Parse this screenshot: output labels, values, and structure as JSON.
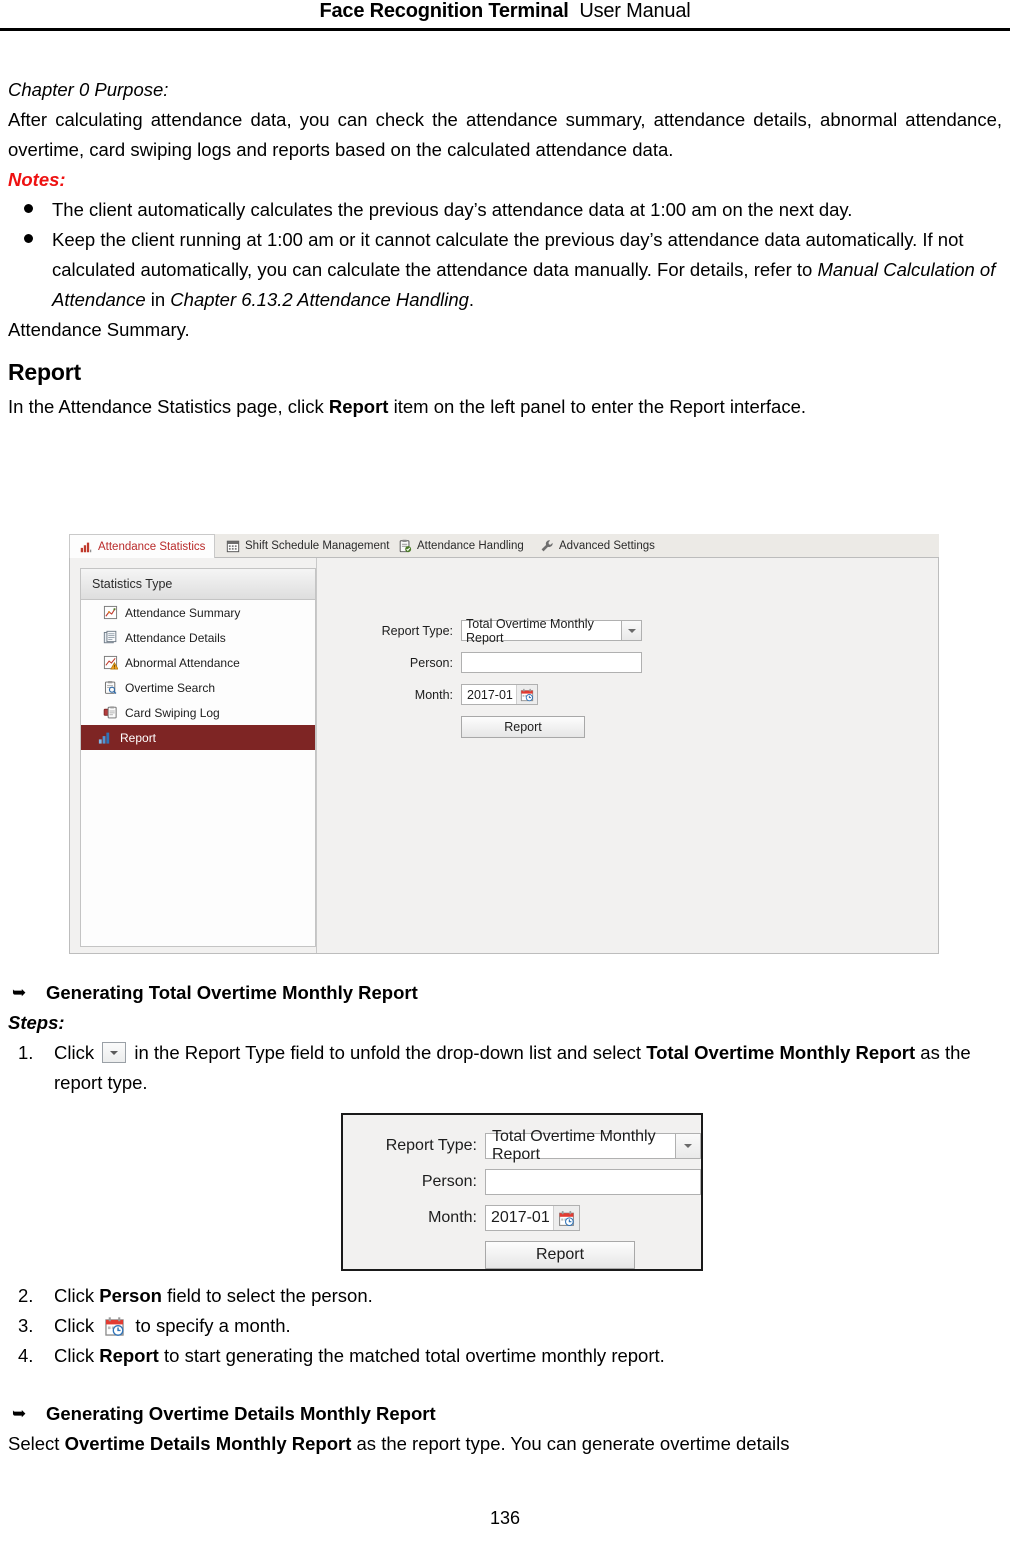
{
  "header": {
    "title_bold": "Face Recognition Terminal",
    "title_regular": "User Manual"
  },
  "content": {
    "chapter_purpose_label": "Chapter 0 Purpose:",
    "purpose_paragraph": "After calculating attendance data, you can check the attendance summary, attendance details, abnormal attendance, overtime, card swiping logs and reports based on the calculated attendance data.",
    "notes_label": "Notes:",
    "notes": [
      "The client automatically calculates the previous day’s attendance data at 1:00 am on the next day.",
      "Keep the client running at 1:00 am or it cannot calculate the previous day’s attendance data automatically. If not calculated automatically, you can calculate the attendance data manually. For details, refer to "
    ],
    "note2_italic_a": "Manual Calculation of Attendance",
    "note2_mid": " in ",
    "note2_italic_b": "Chapter 6.13.2 Attendance Handling",
    "note2_end": ".",
    "attendance_summary_line": "Attendance Summary.",
    "section_heading": "Report",
    "intro_a": "In the Attendance Statistics page, click ",
    "intro_bold": "Report",
    "intro_b": " item on the left panel to enter the Report interface."
  },
  "screenshot": {
    "tabs": [
      {
        "label": "Attendance Statistics",
        "icon": "bar-chart-icon",
        "active": true
      },
      {
        "label": "Shift Schedule Management",
        "icon": "calendar-grid-icon",
        "active": false
      },
      {
        "label": "Attendance Handling",
        "icon": "clipboard-check-icon",
        "active": false
      },
      {
        "label": "Advanced Settings",
        "icon": "wrench-icon",
        "active": false
      }
    ],
    "sidebar": {
      "title": "Statistics Type",
      "items": [
        {
          "label": "Attendance Summary",
          "icon": "chart-line-icon",
          "selected": false
        },
        {
          "label": "Attendance Details",
          "icon": "document-list-icon",
          "selected": false
        },
        {
          "label": "Abnormal Attendance",
          "icon": "warning-chart-icon",
          "selected": false
        },
        {
          "label": "Overtime Search",
          "icon": "clipboard-search-icon",
          "selected": false
        },
        {
          "label": "Card Swiping Log",
          "icon": "card-stack-icon",
          "selected": false
        },
        {
          "label": "Report",
          "icon": "bar-report-icon",
          "selected": true
        }
      ]
    },
    "form": {
      "report_type_label": "Report Type:",
      "report_type_value": "Total Overtime Monthly Report",
      "person_label": "Person:",
      "person_value": "",
      "month_label": "Month:",
      "month_value": "2017-01",
      "report_button": "Report"
    },
    "colors": {
      "selected_item_bg": "#7e2524",
      "active_tab_text": "#b92b2b",
      "panel_bg": "#f2f1f0"
    }
  },
  "steps_section": {
    "heading1": "Generating Total Overtime Monthly Report",
    "steps_label": "Steps:",
    "step1_num": "1.",
    "step1_a": "Click ",
    "step1_b": " in the Report Type field to unfold the drop-down list and select ",
    "step1_bold": "Total Overtime Monthly Report",
    "step1_c": " as the report type.",
    "step2_num": "2.",
    "step2_a": "Click ",
    "step2_bold": "Person",
    "step2_b": " field to select the person.",
    "step3_num": "3.",
    "step3_a": "Click ",
    "step3_b": " to specify a month.",
    "step4_num": "4.",
    "step4_a": "Click ",
    "step4_bold": "Report",
    "step4_b": " to start generating the matched total overtime monthly report.",
    "heading2": "Generating Overtime Details Monthly Report",
    "tail_a": "Select ",
    "tail_bold": "Overtime Details Monthly Report",
    "tail_b": " as the report type. You can generate overtime details"
  },
  "footer": {
    "page_number": "136"
  }
}
